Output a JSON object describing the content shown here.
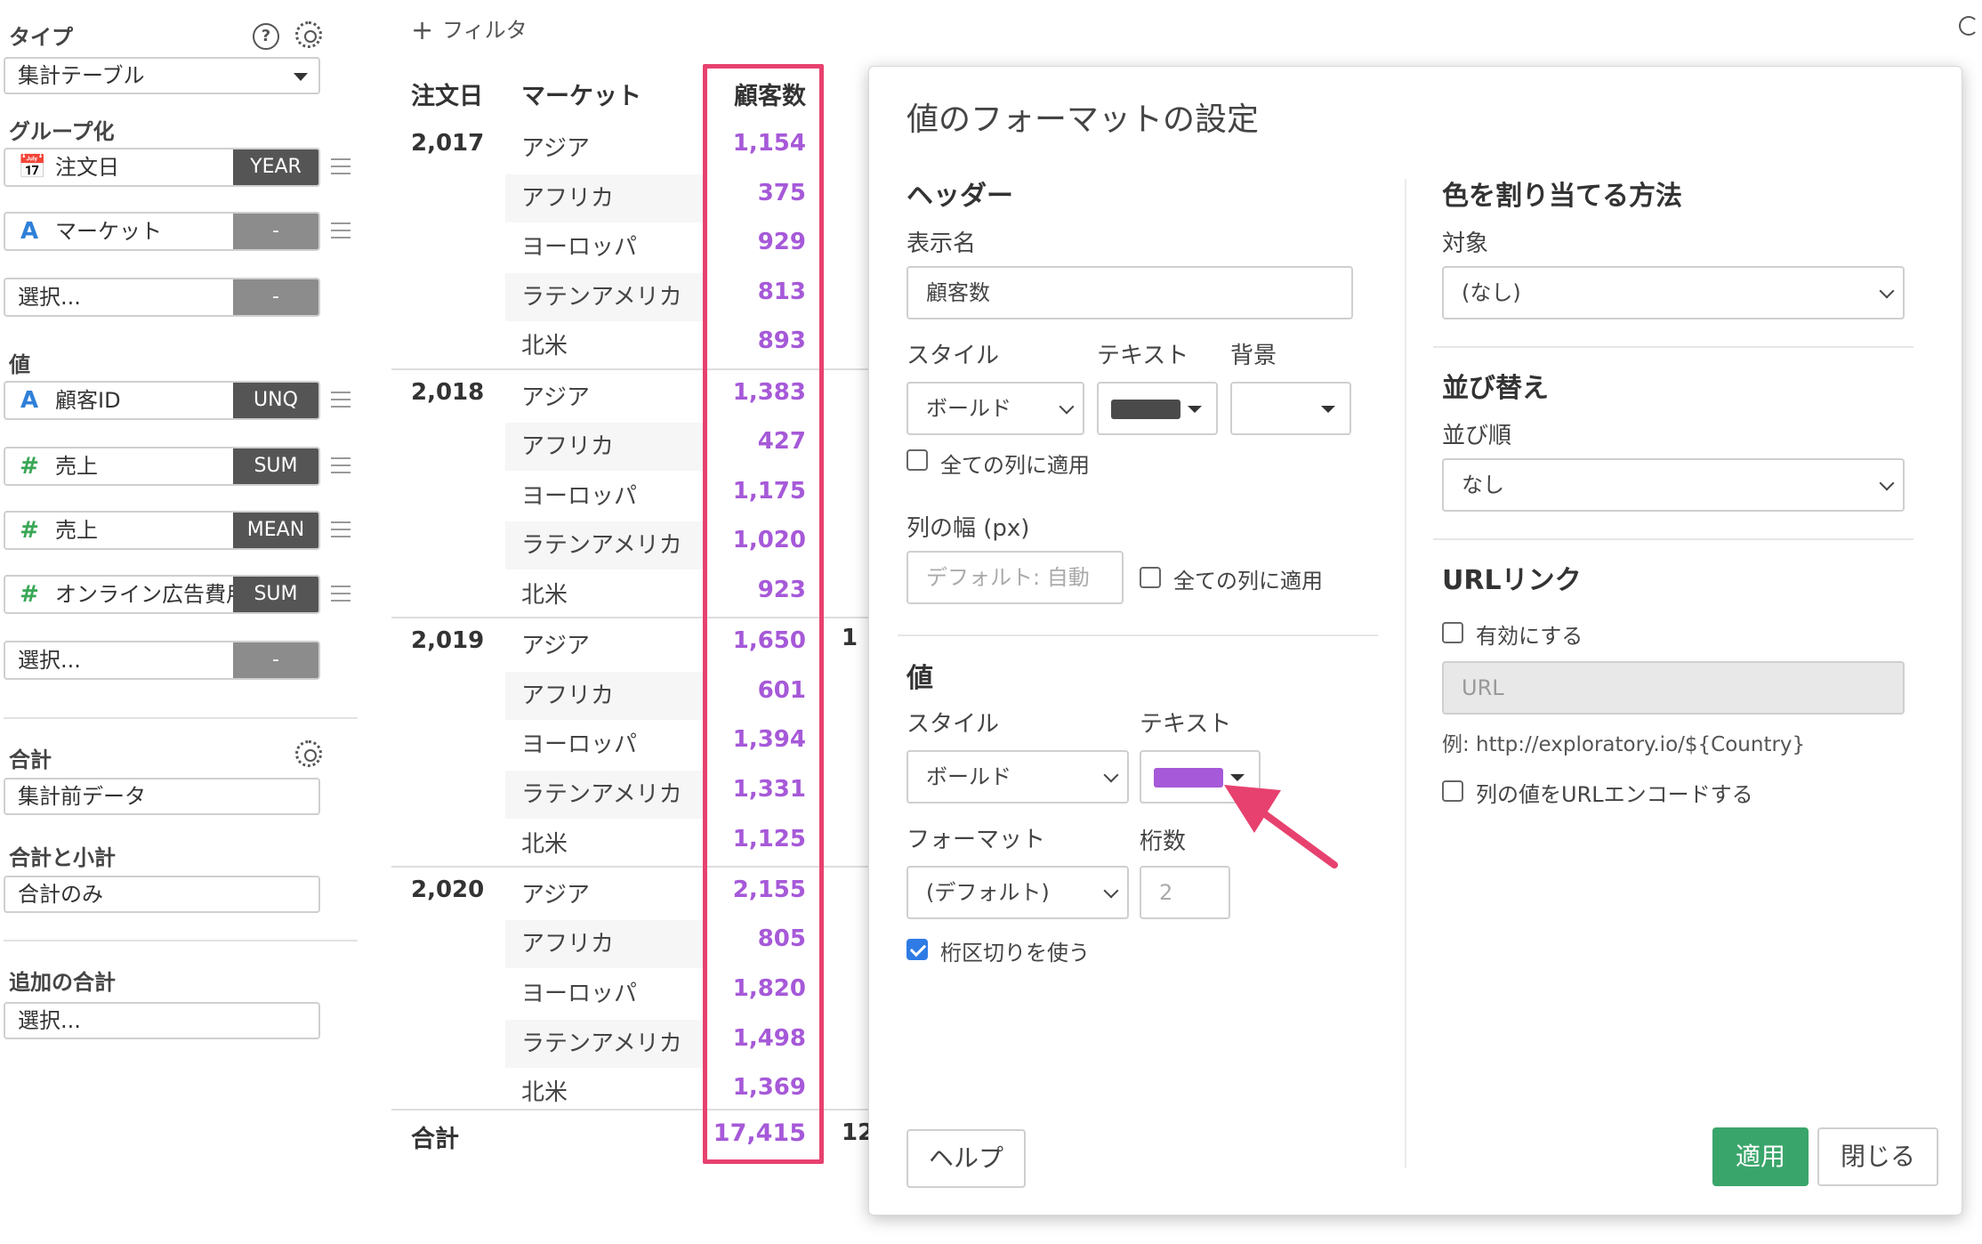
{
  "sidebar": {
    "type_title": "タイプ",
    "type_value": "集計テーブル",
    "group_title": "グループ化",
    "groups": [
      {
        "icon": "calendar-icon",
        "label": "注文日",
        "agg": "YEAR"
      },
      {
        "icon": "text-type-icon",
        "icon_char": "A",
        "label": "マーケット",
        "agg": "-"
      },
      {
        "label": "選択...",
        "agg": "-"
      }
    ],
    "values_title": "値",
    "values": [
      {
        "icon": "text-type-icon",
        "icon_char": "A",
        "label": "顧客ID",
        "agg": "UNQ"
      },
      {
        "icon": "number-type-icon",
        "icon_char": "#",
        "label": "売上",
        "agg": "SUM"
      },
      {
        "icon": "number-type-icon",
        "icon_char": "#",
        "label": "売上",
        "agg": "MEAN"
      },
      {
        "icon": "number-type-icon",
        "icon_char": "#",
        "label": "オンライン広告費用",
        "agg": "SUM"
      },
      {
        "label": "選択...",
        "agg": "-"
      }
    ],
    "total_title": "合計",
    "total_value": "集計前データ",
    "subtotal_title": "合計と小計",
    "subtotal_value": "合計のみ",
    "extra_title": "追加の合計",
    "extra_value": "選択...",
    "help_char": "?"
  },
  "filter": {
    "plus": "+",
    "label": "フィルタ"
  },
  "table": {
    "headers": {
      "date": "注文日",
      "market": "マーケット",
      "customers": "顧客数"
    },
    "years": [
      {
        "year": "2,017",
        "rows": [
          {
            "market": "アジア",
            "value": "1,154"
          },
          {
            "market": "アフリカ",
            "value": "375"
          },
          {
            "market": "ヨーロッパ",
            "value": "929"
          },
          {
            "market": "ラテンアメリカ",
            "value": "813"
          },
          {
            "market": "北米",
            "value": "893"
          }
        ]
      },
      {
        "year": "2,018",
        "rows": [
          {
            "market": "アジア",
            "value": "1,383"
          },
          {
            "market": "アフリカ",
            "value": "427"
          },
          {
            "market": "ヨーロッパ",
            "value": "1,175"
          },
          {
            "market": "ラテンアメリカ",
            "value": "1,020"
          },
          {
            "market": "北米",
            "value": "923"
          }
        ]
      },
      {
        "year": "2,019",
        "rows": [
          {
            "market": "アジア",
            "value": "1,650"
          },
          {
            "market": "アフリカ",
            "value": "601"
          },
          {
            "market": "ヨーロッパ",
            "value": "1,394"
          },
          {
            "market": "ラテンアメリカ",
            "value": "1,331"
          },
          {
            "market": "北米",
            "value": "1,125"
          }
        ]
      },
      {
        "year": "2,020",
        "rows": [
          {
            "market": "アジア",
            "value": "2,155"
          },
          {
            "market": "アフリカ",
            "value": "805"
          },
          {
            "market": "ヨーロッパ",
            "value": "1,820"
          },
          {
            "market": "ラテンアメリカ",
            "value": "1,498"
          },
          {
            "market": "北米",
            "value": "1,369"
          }
        ]
      }
    ],
    "total_label": "合計",
    "total_value": "17,415",
    "peek_row": "1",
    "peek_total": "12",
    "value_color": "#a659d8",
    "highlight_color": "#e7416f"
  },
  "dialog": {
    "title": "値のフォーマットの設定",
    "header_section": {
      "title": "ヘッダー",
      "display_name_label": "表示名",
      "display_name_value": "顧客数",
      "style_label": "スタイル",
      "style_value": "ボールド",
      "text_label": "テキスト",
      "text_color": "#4a4a4a",
      "bg_label": "背景",
      "apply_all_label": "全ての列に適用",
      "width_label": "列の幅 (px)",
      "width_placeholder": "デフォルト: 自動",
      "width_apply_all_label": "全ての列に適用"
    },
    "value_section": {
      "title": "値",
      "style_label": "スタイル",
      "style_value": "ボールド",
      "text_label": "テキスト",
      "text_color": "#a659d8",
      "format_label": "フォーマット",
      "format_value": "(デフォルト)",
      "digits_label": "桁数",
      "digits_placeholder": "2",
      "separator_label": "桁区切りを使う",
      "separator_checked": true
    },
    "color_section": {
      "title": "色を割り当てる方法",
      "target_label": "対象",
      "target_value": "(なし)"
    },
    "sort_section": {
      "title": "並び替え",
      "order_label": "並び順",
      "order_value": "なし"
    },
    "url_section": {
      "title": "URLリンク",
      "enable_label": "有効にする",
      "url_placeholder": "URL",
      "example": "例: http://exploratory.io/${Country}",
      "encode_label": "列の値をURLエンコードする"
    },
    "buttons": {
      "help": "ヘルプ",
      "apply": "適用",
      "close": "閉じる"
    },
    "apply_color": "#3aa56a",
    "arrow_color": "#e7416f"
  }
}
